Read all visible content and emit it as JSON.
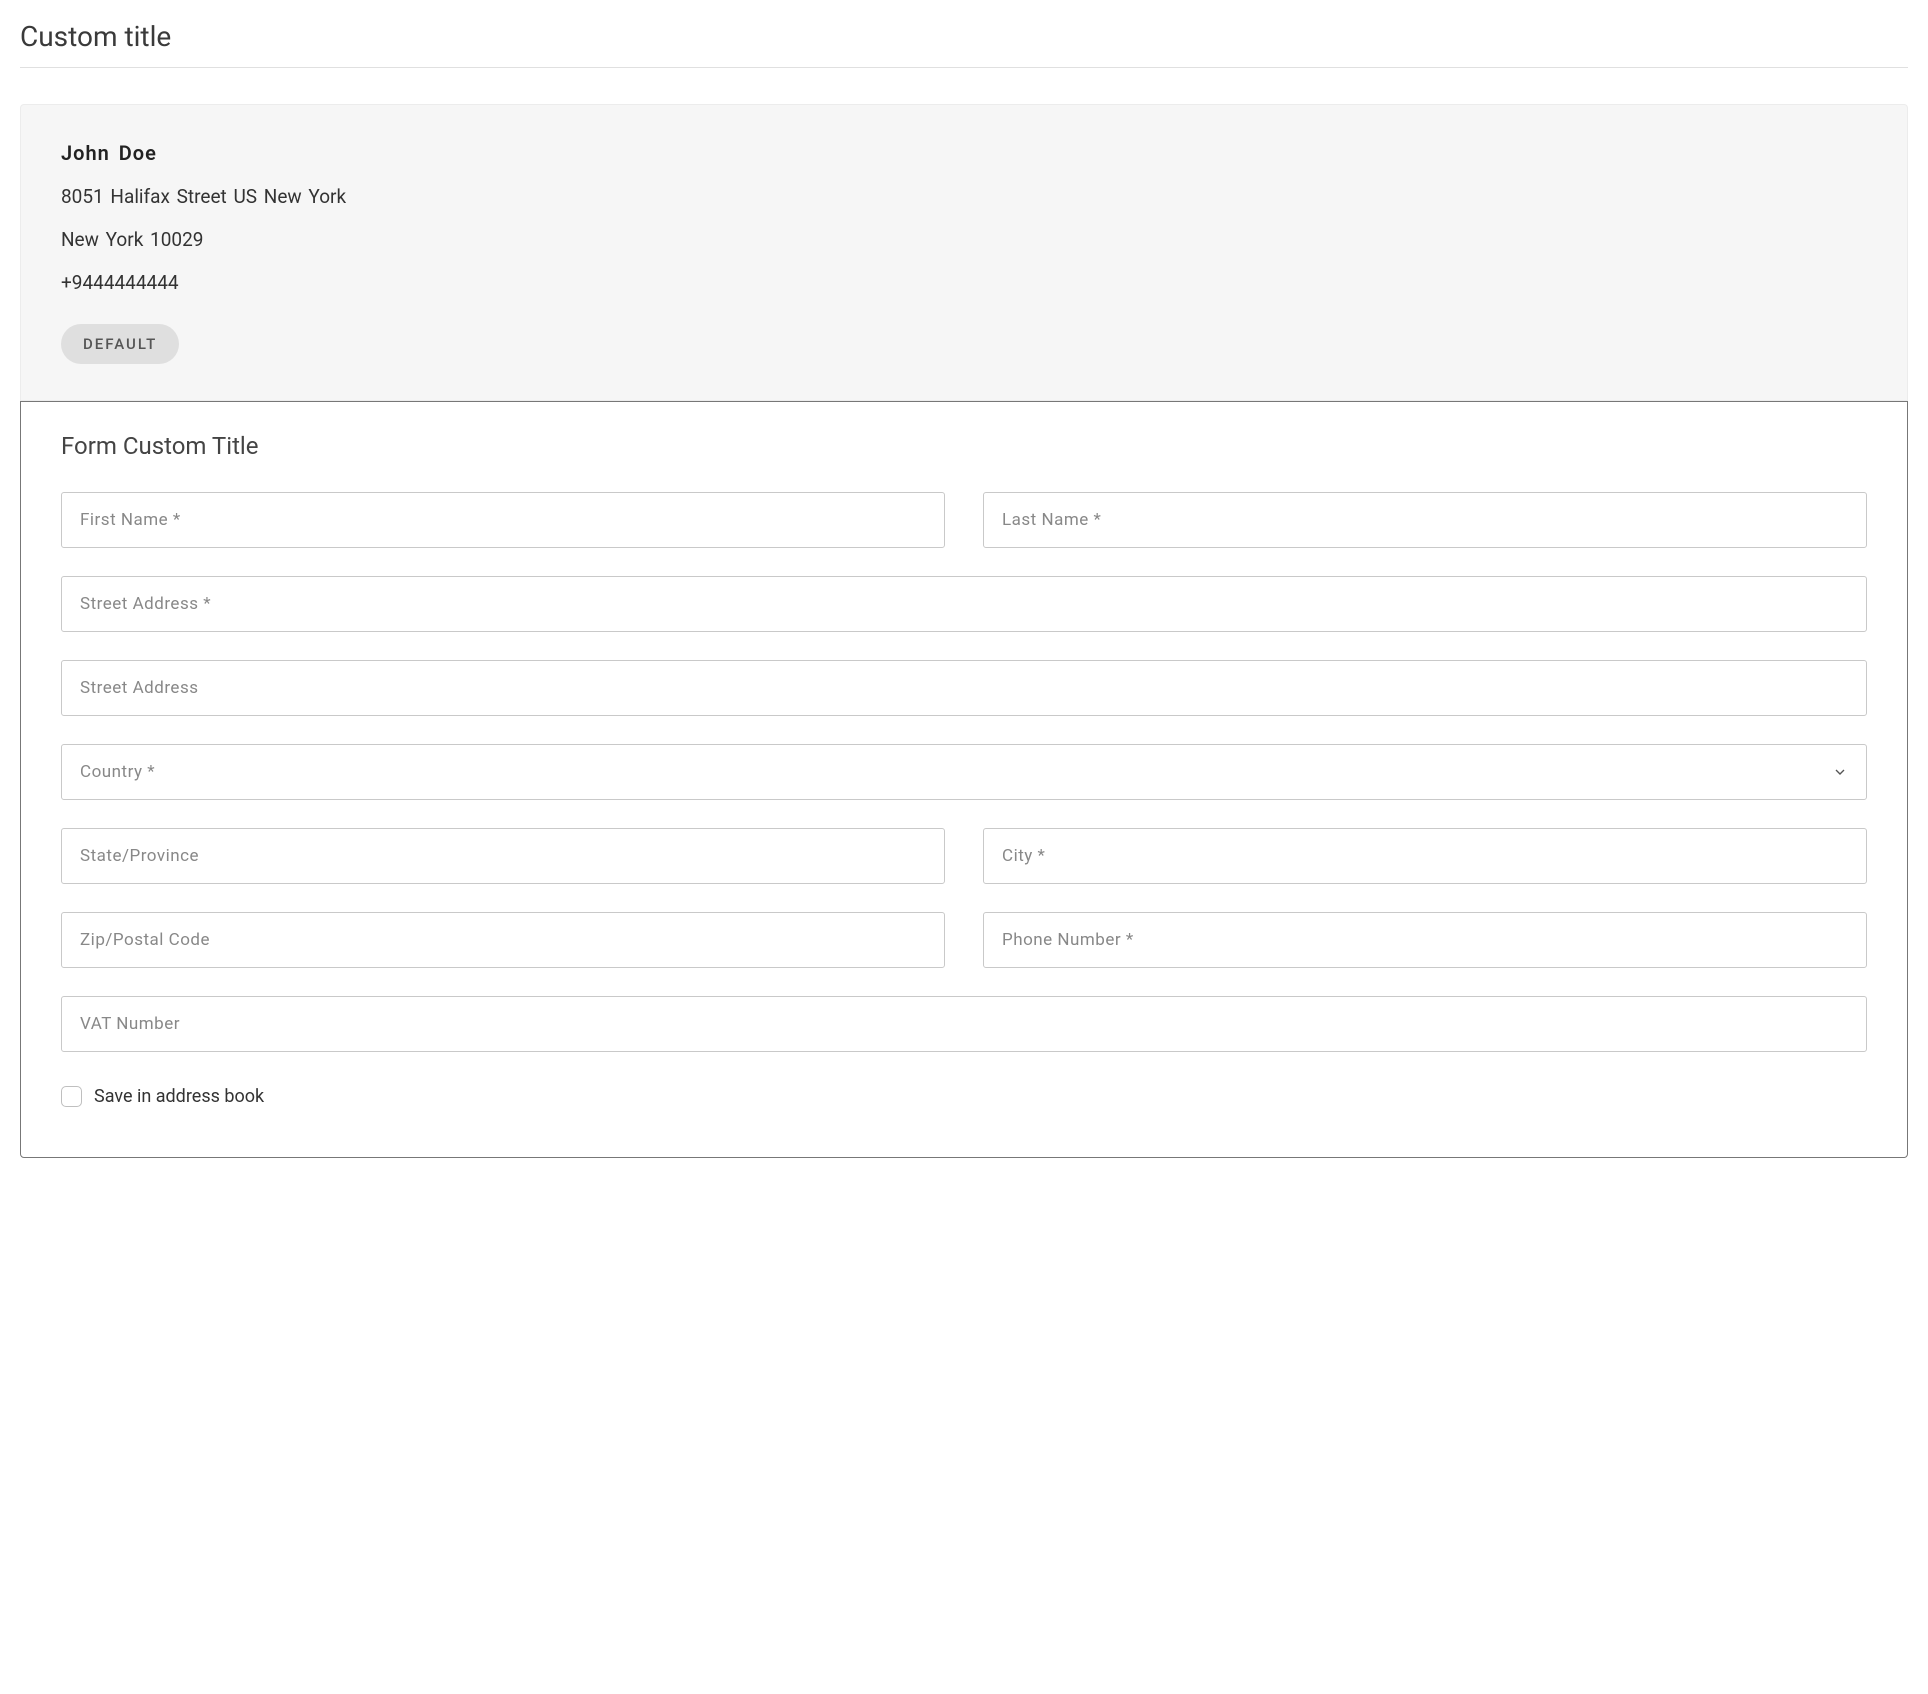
{
  "page": {
    "title": "Custom title"
  },
  "address": {
    "first_name": "John",
    "last_name": "Doe",
    "line1": "8051 Halifax Street  US  New York",
    "line2": "New York  10029",
    "phone": "+9444444444",
    "badge": "DEFAULT"
  },
  "form": {
    "title": "Form Custom Title",
    "fields": {
      "first_name": {
        "placeholder": "First Name *",
        "value": ""
      },
      "last_name": {
        "placeholder": "Last Name *",
        "value": ""
      },
      "street1": {
        "placeholder": "Street Address *",
        "value": ""
      },
      "street2": {
        "placeholder": "Street Address",
        "value": ""
      },
      "country": {
        "placeholder": "Country *",
        "value": ""
      },
      "state": {
        "placeholder": "State/Province",
        "value": ""
      },
      "city": {
        "placeholder": "City *",
        "value": ""
      },
      "zip": {
        "placeholder": "Zip/Postal Code",
        "value": ""
      },
      "phone": {
        "placeholder": "Phone Number *",
        "value": ""
      },
      "vat": {
        "placeholder": "VAT Number",
        "value": ""
      }
    },
    "save_checkbox": {
      "label": "Save in address book",
      "checked": false
    }
  }
}
